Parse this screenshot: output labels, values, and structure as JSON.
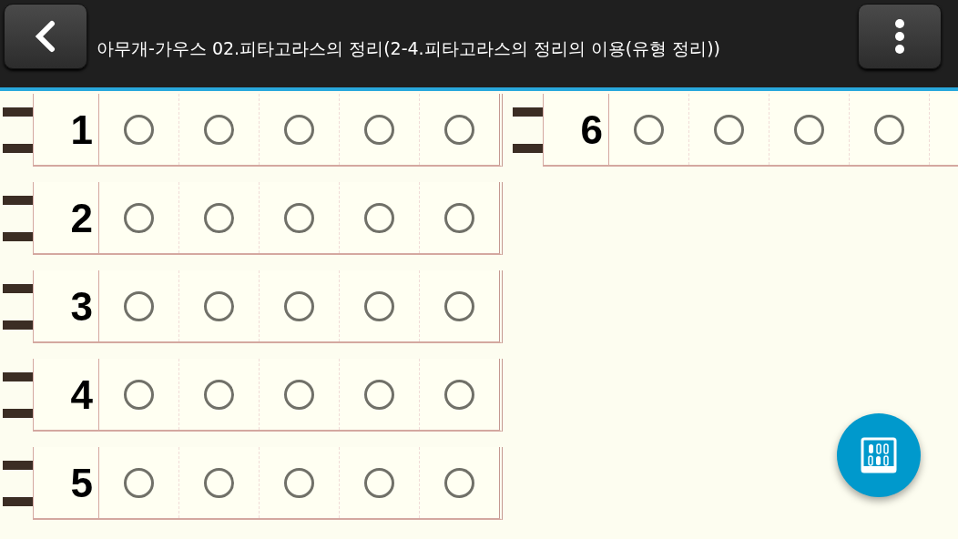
{
  "header": {
    "title": "아무개-가우스 02.피타고라스의 정리(2-4.피타고라스의 정리의 이용(유형 정리))"
  },
  "questions": [
    {
      "number": "1",
      "choices": [
        {
          "selected": false
        },
        {
          "selected": false
        },
        {
          "selected": false
        },
        {
          "selected": false
        },
        {
          "selected": false
        }
      ]
    },
    {
      "number": "2",
      "choices": [
        {
          "selected": false
        },
        {
          "selected": false
        },
        {
          "selected": false
        },
        {
          "selected": false
        },
        {
          "selected": false
        }
      ]
    },
    {
      "number": "3",
      "choices": [
        {
          "selected": false
        },
        {
          "selected": false
        },
        {
          "selected": false
        },
        {
          "selected": false
        },
        {
          "selected": false
        }
      ]
    },
    {
      "number": "4",
      "choices": [
        {
          "selected": false
        },
        {
          "selected": false
        },
        {
          "selected": false
        },
        {
          "selected": false
        },
        {
          "selected": false
        }
      ]
    },
    {
      "number": "5",
      "choices": [
        {
          "selected": false
        },
        {
          "selected": false
        },
        {
          "selected": false
        },
        {
          "selected": false
        },
        {
          "selected": false
        }
      ]
    },
    {
      "number": "6",
      "choices": [
        {
          "selected": false
        },
        {
          "selected": false
        },
        {
          "selected": false
        },
        {
          "selected": false
        }
      ]
    }
  ]
}
